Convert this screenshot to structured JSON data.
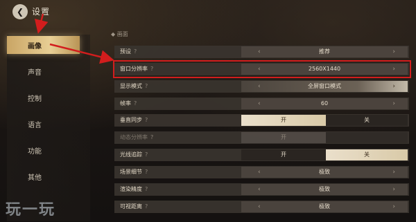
{
  "header": {
    "title": "设置",
    "back_icon": "back-arrow-icon"
  },
  "sidebar": {
    "items": [
      {
        "label": "画像",
        "active": true
      },
      {
        "label": "声音",
        "active": false
      },
      {
        "label": "控制",
        "active": false
      },
      {
        "label": "语言",
        "active": false
      },
      {
        "label": "功能",
        "active": false
      },
      {
        "label": "其他",
        "active": false
      }
    ]
  },
  "section": {
    "title": "画面"
  },
  "rows": [
    {
      "label": "预设",
      "type": "select",
      "value": "推荐",
      "dim": false
    },
    {
      "label": "窗口分辨率",
      "type": "select",
      "value": "2560X1440",
      "dim": false,
      "highlighted": true
    },
    {
      "label": "显示模式",
      "type": "select",
      "value": "全屏窗口模式",
      "dim": false
    },
    {
      "label": "帧率",
      "type": "select",
      "value": "60",
      "dim": false
    },
    {
      "label": "垂直同步",
      "type": "toggle",
      "on_label": "开",
      "off_label": "关",
      "selected": "开",
      "dim": false
    },
    {
      "label": "动态分辨率",
      "type": "toggle",
      "on_label": "开",
      "off_label": "",
      "selected": "开",
      "dim": true
    },
    {
      "label": "光线追踪",
      "type": "toggle",
      "on_label": "开",
      "off_label": "关",
      "selected": "关",
      "dim": false
    },
    {
      "label": "场景细节",
      "type": "select",
      "value": "极致",
      "dim": false
    },
    {
      "label": "渲染精度",
      "type": "select",
      "value": "极致",
      "dim": false
    },
    {
      "label": "可视距离",
      "type": "select",
      "value": "极致",
      "dim": false
    }
  ],
  "watermark": "玩一玩",
  "colors": {
    "accent_gold": "#e8cf95",
    "annotation_red": "#d21d1d"
  }
}
